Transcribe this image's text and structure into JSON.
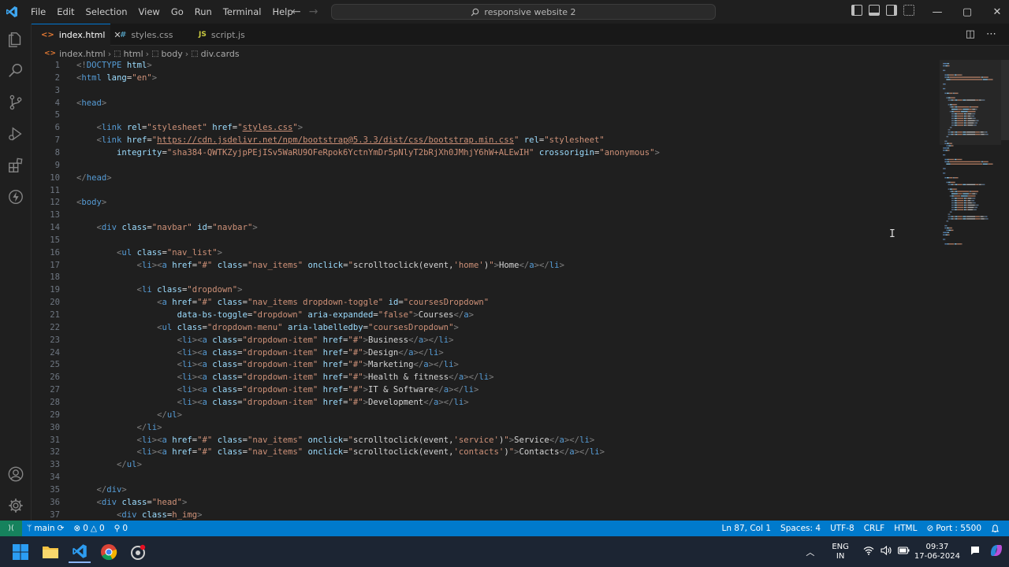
{
  "menu": [
    "File",
    "Edit",
    "Selection",
    "View",
    "Go",
    "Run",
    "Terminal",
    "Help"
  ],
  "search": {
    "text": "responsive website 2"
  },
  "tabs": [
    {
      "label": "index.html",
      "icon": "<>",
      "icon_color": "#e37933",
      "active": true,
      "close": "✕"
    },
    {
      "label": "styles.css",
      "icon": "#",
      "icon_color": "#519aba",
      "active": false
    },
    {
      "label": "script.js",
      "icon": "JS",
      "icon_color": "#cbcb41",
      "active": false
    }
  ],
  "breadcrumb": [
    "index.html",
    "html",
    "body",
    "div.cards"
  ],
  "code": [
    [
      [
        "t",
        "<!"
      ],
      [
        "n",
        "DOCTYPE"
      ],
      [
        "x",
        " "
      ],
      [
        "a",
        "html"
      ],
      [
        "t",
        ">"
      ]
    ],
    [
      [
        "t",
        "<"
      ],
      [
        "n",
        "html"
      ],
      [
        "x",
        " "
      ],
      [
        "a",
        "lang"
      ],
      [
        "x",
        "="
      ],
      [
        "s",
        "\"en\""
      ],
      [
        "t",
        ">"
      ]
    ],
    [],
    [
      [
        "t",
        "<"
      ],
      [
        "n",
        "head"
      ],
      [
        "t",
        ">"
      ]
    ],
    [],
    [
      [
        "x",
        "    "
      ],
      [
        "t",
        "<"
      ],
      [
        "n",
        "link"
      ],
      [
        "x",
        " "
      ],
      [
        "a",
        "rel"
      ],
      [
        "x",
        "="
      ],
      [
        "s",
        "\"stylesheet\""
      ],
      [
        "x",
        " "
      ],
      [
        "a",
        "href"
      ],
      [
        "x",
        "="
      ],
      [
        "s",
        "\""
      ],
      [
        "l",
        "styles.css"
      ],
      [
        "s",
        "\""
      ],
      [
        "t",
        ">"
      ]
    ],
    [
      [
        "x",
        "    "
      ],
      [
        "t",
        "<"
      ],
      [
        "n",
        "link"
      ],
      [
        "x",
        " "
      ],
      [
        "a",
        "href"
      ],
      [
        "x",
        "="
      ],
      [
        "s",
        "\""
      ],
      [
        "l",
        "https://cdn.jsdelivr.net/npm/bootstrap@5.3.3/dist/css/bootstrap.min.css"
      ],
      [
        "s",
        "\""
      ],
      [
        "x",
        " "
      ],
      [
        "a",
        "rel"
      ],
      [
        "x",
        "="
      ],
      [
        "s",
        "\"stylesheet\""
      ]
    ],
    [
      [
        "x",
        "        "
      ],
      [
        "a",
        "integrity"
      ],
      [
        "x",
        "="
      ],
      [
        "s",
        "\"sha384-QWTKZyjpPEjISv5WaRU9OFeRpok6YctnYmDr5pNlyT2bRjXh0JMhjY6hW+ALEwIH\""
      ],
      [
        "x",
        " "
      ],
      [
        "a",
        "crossorigin"
      ],
      [
        "x",
        "="
      ],
      [
        "s",
        "\"anonymous\""
      ],
      [
        "t",
        ">"
      ]
    ],
    [],
    [
      [
        "t",
        "</"
      ],
      [
        "n",
        "head"
      ],
      [
        "t",
        ">"
      ]
    ],
    [],
    [
      [
        "t",
        "<"
      ],
      [
        "n",
        "body"
      ],
      [
        "t",
        ">"
      ]
    ],
    [],
    [
      [
        "x",
        "    "
      ],
      [
        "t",
        "<"
      ],
      [
        "n",
        "div"
      ],
      [
        "x",
        " "
      ],
      [
        "a",
        "class"
      ],
      [
        "x",
        "="
      ],
      [
        "s",
        "\"navbar\""
      ],
      [
        "x",
        " "
      ],
      [
        "a",
        "id"
      ],
      [
        "x",
        "="
      ],
      [
        "s",
        "\"navbar\""
      ],
      [
        "t",
        ">"
      ]
    ],
    [],
    [
      [
        "x",
        "        "
      ],
      [
        "t",
        "<"
      ],
      [
        "n",
        "ul"
      ],
      [
        "x",
        " "
      ],
      [
        "a",
        "class"
      ],
      [
        "x",
        "="
      ],
      [
        "s",
        "\"nav_list\""
      ],
      [
        "t",
        ">"
      ]
    ],
    [
      [
        "x",
        "            "
      ],
      [
        "t",
        "<"
      ],
      [
        "n",
        "li"
      ],
      [
        "t",
        "><"
      ],
      [
        "n",
        "a"
      ],
      [
        "x",
        " "
      ],
      [
        "a",
        "href"
      ],
      [
        "x",
        "="
      ],
      [
        "s",
        "\"#\""
      ],
      [
        "x",
        " "
      ],
      [
        "a",
        "class"
      ],
      [
        "x",
        "="
      ],
      [
        "s",
        "\"nav_items\""
      ],
      [
        "x",
        " "
      ],
      [
        "a",
        "onclick"
      ],
      [
        "x",
        "="
      ],
      [
        "s",
        "\""
      ],
      [
        "x",
        "scrolltoclick(event,"
      ],
      [
        "s",
        "'home'"
      ],
      [
        "x",
        ")"
      ],
      [
        "s",
        "\""
      ],
      [
        "t",
        ">"
      ],
      [
        "x",
        "Home"
      ],
      [
        "t",
        "</"
      ],
      [
        "n",
        "a"
      ],
      [
        "t",
        "></"
      ],
      [
        "n",
        "li"
      ],
      [
        "t",
        ">"
      ]
    ],
    [],
    [
      [
        "x",
        "            "
      ],
      [
        "t",
        "<"
      ],
      [
        "n",
        "li"
      ],
      [
        "x",
        " "
      ],
      [
        "a",
        "class"
      ],
      [
        "x",
        "="
      ],
      [
        "s",
        "\"dropdown\""
      ],
      [
        "t",
        ">"
      ]
    ],
    [
      [
        "x",
        "                "
      ],
      [
        "t",
        "<"
      ],
      [
        "n",
        "a"
      ],
      [
        "x",
        " "
      ],
      [
        "a",
        "href"
      ],
      [
        "x",
        "="
      ],
      [
        "s",
        "\"#\""
      ],
      [
        "x",
        " "
      ],
      [
        "a",
        "class"
      ],
      [
        "x",
        "="
      ],
      [
        "s",
        "\"nav_items dropdown-toggle\""
      ],
      [
        "x",
        " "
      ],
      [
        "a",
        "id"
      ],
      [
        "x",
        "="
      ],
      [
        "s",
        "\"coursesDropdown\""
      ]
    ],
    [
      [
        "x",
        "                    "
      ],
      [
        "a",
        "data-bs-toggle"
      ],
      [
        "x",
        "="
      ],
      [
        "s",
        "\"dropdown\""
      ],
      [
        "x",
        " "
      ],
      [
        "a",
        "aria-expanded"
      ],
      [
        "x",
        "="
      ],
      [
        "s",
        "\"false\""
      ],
      [
        "t",
        ">"
      ],
      [
        "x",
        "Courses"
      ],
      [
        "t",
        "</"
      ],
      [
        "n",
        "a"
      ],
      [
        "t",
        ">"
      ]
    ],
    [
      [
        "x",
        "                "
      ],
      [
        "t",
        "<"
      ],
      [
        "n",
        "ul"
      ],
      [
        "x",
        " "
      ],
      [
        "a",
        "class"
      ],
      [
        "x",
        "="
      ],
      [
        "s",
        "\"dropdown-menu\""
      ],
      [
        "x",
        " "
      ],
      [
        "a",
        "aria-labelledby"
      ],
      [
        "x",
        "="
      ],
      [
        "s",
        "\"coursesDropdown\""
      ],
      [
        "t",
        ">"
      ]
    ],
    [
      [
        "x",
        "                    "
      ],
      [
        "t",
        "<"
      ],
      [
        "n",
        "li"
      ],
      [
        "t",
        "><"
      ],
      [
        "n",
        "a"
      ],
      [
        "x",
        " "
      ],
      [
        "a",
        "class"
      ],
      [
        "x",
        "="
      ],
      [
        "s",
        "\"dropdown-item\""
      ],
      [
        "x",
        " "
      ],
      [
        "a",
        "href"
      ],
      [
        "x",
        "="
      ],
      [
        "s",
        "\"#\""
      ],
      [
        "t",
        ">"
      ],
      [
        "x",
        "Business"
      ],
      [
        "t",
        "</"
      ],
      [
        "n",
        "a"
      ],
      [
        "t",
        "></"
      ],
      [
        "n",
        "li"
      ],
      [
        "t",
        ">"
      ]
    ],
    [
      [
        "x",
        "                    "
      ],
      [
        "t",
        "<"
      ],
      [
        "n",
        "li"
      ],
      [
        "t",
        "><"
      ],
      [
        "n",
        "a"
      ],
      [
        "x",
        " "
      ],
      [
        "a",
        "class"
      ],
      [
        "x",
        "="
      ],
      [
        "s",
        "\"dropdown-item\""
      ],
      [
        "x",
        " "
      ],
      [
        "a",
        "href"
      ],
      [
        "x",
        "="
      ],
      [
        "s",
        "\"#\""
      ],
      [
        "t",
        ">"
      ],
      [
        "x",
        "Design"
      ],
      [
        "t",
        "</"
      ],
      [
        "n",
        "a"
      ],
      [
        "t",
        "></"
      ],
      [
        "n",
        "li"
      ],
      [
        "t",
        ">"
      ]
    ],
    [
      [
        "x",
        "                    "
      ],
      [
        "t",
        "<"
      ],
      [
        "n",
        "li"
      ],
      [
        "t",
        "><"
      ],
      [
        "n",
        "a"
      ],
      [
        "x",
        " "
      ],
      [
        "a",
        "class"
      ],
      [
        "x",
        "="
      ],
      [
        "s",
        "\"dropdown-item\""
      ],
      [
        "x",
        " "
      ],
      [
        "a",
        "href"
      ],
      [
        "x",
        "="
      ],
      [
        "s",
        "\"#\""
      ],
      [
        "t",
        ">"
      ],
      [
        "x",
        "Marketing"
      ],
      [
        "t",
        "</"
      ],
      [
        "n",
        "a"
      ],
      [
        "t",
        "></"
      ],
      [
        "n",
        "li"
      ],
      [
        "t",
        ">"
      ]
    ],
    [
      [
        "x",
        "                    "
      ],
      [
        "t",
        "<"
      ],
      [
        "n",
        "li"
      ],
      [
        "t",
        "><"
      ],
      [
        "n",
        "a"
      ],
      [
        "x",
        " "
      ],
      [
        "a",
        "class"
      ],
      [
        "x",
        "="
      ],
      [
        "s",
        "\"dropdown-item\""
      ],
      [
        "x",
        " "
      ],
      [
        "a",
        "href"
      ],
      [
        "x",
        "="
      ],
      [
        "s",
        "\"#\""
      ],
      [
        "t",
        ">"
      ],
      [
        "x",
        "Health & fitness"
      ],
      [
        "t",
        "</"
      ],
      [
        "n",
        "a"
      ],
      [
        "t",
        "></"
      ],
      [
        "n",
        "li"
      ],
      [
        "t",
        ">"
      ]
    ],
    [
      [
        "x",
        "                    "
      ],
      [
        "t",
        "<"
      ],
      [
        "n",
        "li"
      ],
      [
        "t",
        "><"
      ],
      [
        "n",
        "a"
      ],
      [
        "x",
        " "
      ],
      [
        "a",
        "class"
      ],
      [
        "x",
        "="
      ],
      [
        "s",
        "\"dropdown-item\""
      ],
      [
        "x",
        " "
      ],
      [
        "a",
        "href"
      ],
      [
        "x",
        "="
      ],
      [
        "s",
        "\"#\""
      ],
      [
        "t",
        ">"
      ],
      [
        "x",
        "IT & Software"
      ],
      [
        "t",
        "</"
      ],
      [
        "n",
        "a"
      ],
      [
        "t",
        "></"
      ],
      [
        "n",
        "li"
      ],
      [
        "t",
        ">"
      ]
    ],
    [
      [
        "x",
        "                    "
      ],
      [
        "t",
        "<"
      ],
      [
        "n",
        "li"
      ],
      [
        "t",
        "><"
      ],
      [
        "n",
        "a"
      ],
      [
        "x",
        " "
      ],
      [
        "a",
        "class"
      ],
      [
        "x",
        "="
      ],
      [
        "s",
        "\"dropdown-item\""
      ],
      [
        "x",
        " "
      ],
      [
        "a",
        "href"
      ],
      [
        "x",
        "="
      ],
      [
        "s",
        "\"#\""
      ],
      [
        "t",
        ">"
      ],
      [
        "x",
        "Development"
      ],
      [
        "t",
        "</"
      ],
      [
        "n",
        "a"
      ],
      [
        "t",
        "></"
      ],
      [
        "n",
        "li"
      ],
      [
        "t",
        ">"
      ]
    ],
    [
      [
        "x",
        "                "
      ],
      [
        "t",
        "</"
      ],
      [
        "n",
        "ul"
      ],
      [
        "t",
        ">"
      ]
    ],
    [
      [
        "x",
        "            "
      ],
      [
        "t",
        "</"
      ],
      [
        "n",
        "li"
      ],
      [
        "t",
        ">"
      ]
    ],
    [
      [
        "x",
        "            "
      ],
      [
        "t",
        "<"
      ],
      [
        "n",
        "li"
      ],
      [
        "t",
        "><"
      ],
      [
        "n",
        "a"
      ],
      [
        "x",
        " "
      ],
      [
        "a",
        "href"
      ],
      [
        "x",
        "="
      ],
      [
        "s",
        "\"#\""
      ],
      [
        "x",
        " "
      ],
      [
        "a",
        "class"
      ],
      [
        "x",
        "="
      ],
      [
        "s",
        "\"nav_items\""
      ],
      [
        "x",
        " "
      ],
      [
        "a",
        "onclick"
      ],
      [
        "x",
        "="
      ],
      [
        "s",
        "\""
      ],
      [
        "x",
        "scrolltoclick(event,"
      ],
      [
        "s",
        "'service'"
      ],
      [
        "x",
        ")"
      ],
      [
        "s",
        "\""
      ],
      [
        "t",
        ">"
      ],
      [
        "x",
        "Service"
      ],
      [
        "t",
        "</"
      ],
      [
        "n",
        "a"
      ],
      [
        "t",
        "></"
      ],
      [
        "n",
        "li"
      ],
      [
        "t",
        ">"
      ]
    ],
    [
      [
        "x",
        "            "
      ],
      [
        "t",
        "<"
      ],
      [
        "n",
        "li"
      ],
      [
        "t",
        "><"
      ],
      [
        "n",
        "a"
      ],
      [
        "x",
        " "
      ],
      [
        "a",
        "href"
      ],
      [
        "x",
        "="
      ],
      [
        "s",
        "\"#\""
      ],
      [
        "x",
        " "
      ],
      [
        "a",
        "class"
      ],
      [
        "x",
        "="
      ],
      [
        "s",
        "\"nav_items\""
      ],
      [
        "x",
        " "
      ],
      [
        "a",
        "onclick"
      ],
      [
        "x",
        "="
      ],
      [
        "s",
        "\""
      ],
      [
        "x",
        "scrolltoclick(event,"
      ],
      [
        "s",
        "'contacts'"
      ],
      [
        "x",
        ")"
      ],
      [
        "s",
        "\""
      ],
      [
        "t",
        ">"
      ],
      [
        "x",
        "Contacts"
      ],
      [
        "t",
        "</"
      ],
      [
        "n",
        "a"
      ],
      [
        "t",
        "></"
      ],
      [
        "n",
        "li"
      ],
      [
        "t",
        ">"
      ]
    ],
    [
      [
        "x",
        "        "
      ],
      [
        "t",
        "</"
      ],
      [
        "n",
        "ul"
      ],
      [
        "t",
        ">"
      ]
    ],
    [],
    [
      [
        "x",
        "    "
      ],
      [
        "t",
        "</"
      ],
      [
        "n",
        "div"
      ],
      [
        "t",
        ">"
      ]
    ],
    [
      [
        "x",
        "    "
      ],
      [
        "t",
        "<"
      ],
      [
        "n",
        "div"
      ],
      [
        "x",
        " "
      ],
      [
        "a",
        "class"
      ],
      [
        "x",
        "="
      ],
      [
        "s",
        "\"head\""
      ],
      [
        "t",
        ">"
      ]
    ],
    [
      [
        "x",
        "        "
      ],
      [
        "t",
        "<"
      ],
      [
        "n",
        "div"
      ],
      [
        "x",
        " "
      ],
      [
        "a",
        "class"
      ],
      [
        "x",
        "="
      ],
      [
        "s",
        "h_img"
      ],
      [
        "t",
        ">"
      ]
    ]
  ],
  "status": {
    "remote_icon": "⟩⟨",
    "branch": "main",
    "sync_icon": "⟳",
    "errors": "0",
    "warnings": "0",
    "ports_count": "0",
    "position": "Ln 87, Col 1",
    "spaces": "Spaces: 4",
    "encoding": "UTF-8",
    "eol": "CRLF",
    "language": "HTML",
    "port": "Port : 5500",
    "bell_icon": "bell-icon"
  },
  "taskbar": {
    "lang_top": "ENG",
    "lang_bottom": "IN",
    "time": "09:37",
    "date": "17-06-2024"
  },
  "colors": {
    "accent": "#007acc",
    "remote": "#16825d",
    "tab_active_border": "#0078d4"
  }
}
